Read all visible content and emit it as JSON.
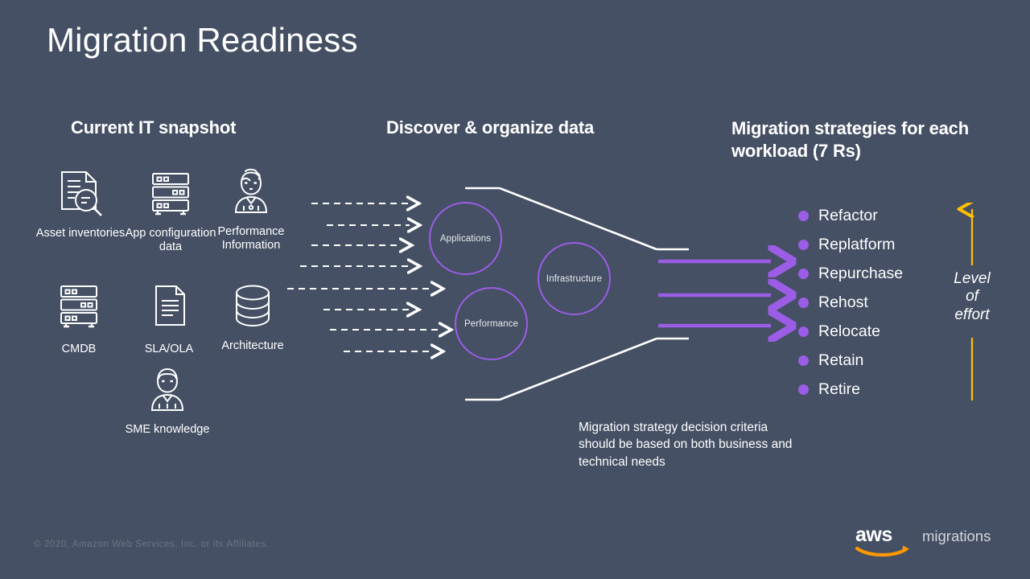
{
  "slide": {
    "title": "Migration Readiness",
    "background_color": "#455064",
    "accent_purple": "#9B5DE5",
    "accent_orange": "#FF9900",
    "accent_yellow": "#FFC000"
  },
  "columns": {
    "snapshot_heading": "Current IT snapshot",
    "discover_heading": "Discover & organize data",
    "strategies_heading": "Migration strategies for each workload (7 Rs)"
  },
  "snapshot_items": [
    {
      "icon": "document-magnifier-icon",
      "label": "Asset inventories"
    },
    {
      "icon": "server-rack-icon",
      "label": "App configuration data"
    },
    {
      "icon": "person-headset-icon",
      "label": "Performance Information"
    },
    {
      "icon": "server-rack-icon",
      "label": "CMDB"
    },
    {
      "icon": "document-lines-icon",
      "label": "SLA/OLA"
    },
    {
      "icon": "database-cylinder-icon",
      "label": "Architecture"
    },
    {
      "icon": "person-expert-icon",
      "label": "SME knowledge"
    }
  ],
  "discover": {
    "bubbles": [
      {
        "label": "Applications"
      },
      {
        "label": "Infrastructure"
      },
      {
        "label": "Performance"
      }
    ],
    "dashed_arrow_count": 8,
    "funnel_caption": "Migration strategy decision criteria should be based on both business and technical needs",
    "output_arrow_count": 3
  },
  "strategies": [
    {
      "label": "Refactor"
    },
    {
      "label": "Replatform"
    },
    {
      "label": "Repurchase"
    },
    {
      "label": "Rehost"
    },
    {
      "label": "Relocate"
    },
    {
      "label": "Retain"
    },
    {
      "label": "Retire"
    }
  ],
  "effort_axis": {
    "line1": "Level",
    "line2": "of",
    "line3": "effort",
    "direction": "up",
    "color": "#FFC000"
  },
  "footer": {
    "copyright": "© 2020, Amazon Web Services, Inc. or its Affiliates.",
    "logo_wordmark": "aws",
    "logo_sub": "migrations"
  }
}
